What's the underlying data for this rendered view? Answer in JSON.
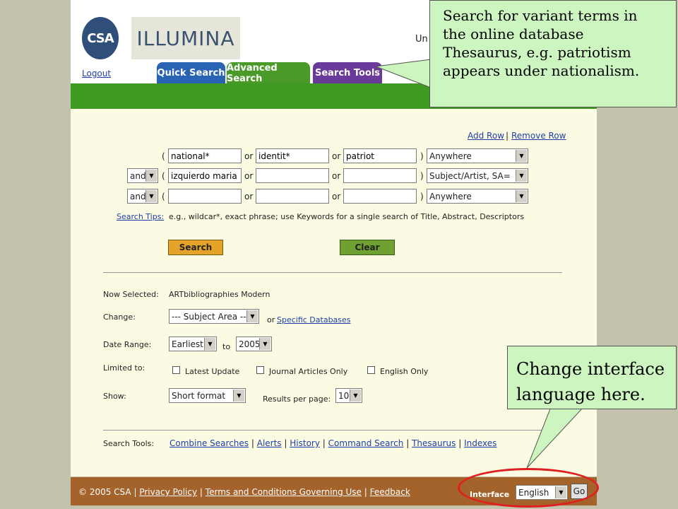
{
  "header": {
    "csa_logo": "CSA",
    "illumina_logo": "ILLUMINA",
    "logout": "Logout",
    "partial_text": "Un"
  },
  "tabs": {
    "quick": "Quick Search",
    "advanced": "Advanced Search",
    "tools": "Search Tools"
  },
  "rows_actions": {
    "add_row": "Add Row",
    "separator": "|",
    "remove_row": "Remove Row"
  },
  "search_rows": [
    {
      "op": "",
      "t1": "national*",
      "t2": "identit*",
      "t3": "patriot",
      "field": "Anywhere"
    },
    {
      "op": "and",
      "t1": "izquierdo maria",
      "t2": "",
      "t3": "",
      "field": "Subject/Artist, SA="
    },
    {
      "op": "and",
      "t1": "",
      "t2": "",
      "t3": "",
      "field": "Anywhere"
    }
  ],
  "words": {
    "open_paren": "(",
    "close_paren": ")",
    "or": "or"
  },
  "tips": {
    "link": "Search Tips:",
    "text": "e.g., wildcar*, exact phrase; use Keywords for a single search of Title, Abstract, Descriptors"
  },
  "buttons": {
    "search": "Search",
    "clear": "Clear"
  },
  "options": {
    "now_selected_label": "Now Selected:",
    "now_selected_value": "ARTbibliographies Modern",
    "change_label": "Change:",
    "subject_area": "--- Subject Area ---",
    "or": "or",
    "specific_db": "Specific Databases",
    "date_range_label": "Date Range:",
    "date_from": "Earliest",
    "to": "to",
    "date_to": "2005",
    "limited_label": "Limited to:",
    "latest_update": "Latest Update",
    "journal_only": "Journal Articles Only",
    "english_only": "English Only",
    "show_label": "Show:",
    "show_value": "Short format",
    "results_label": "Results per page:",
    "results_value": "10"
  },
  "tools_row": {
    "label": "Search Tools:",
    "links": [
      "Combine Searches",
      "Alerts",
      "History",
      "Command Search",
      "Thesaurus",
      "Indexes"
    ]
  },
  "footer": {
    "copyright": "© 2005 CSA",
    "links": [
      "Privacy Policy",
      "Terms and Conditions Governing Use",
      "Feedback"
    ],
    "interface_label": "Interface",
    "language": "English",
    "go": "Go"
  },
  "callouts": {
    "thesaurus_tip": [
      "Search for variant terms in",
      "the online database",
      "Thesaurus, e.g. patriotism",
      "appears under nationalism."
    ],
    "language_tip": [
      "Change interface",
      "language here."
    ]
  },
  "colors": {
    "callout_bg": "#ccf5bf",
    "tab_quick": "#2a63b3",
    "tab_advanced": "#4a9a2a",
    "tab_tools": "#6a3a9a",
    "footer_bg": "#a5632c",
    "highlight_ellipse": "#e02020"
  }
}
